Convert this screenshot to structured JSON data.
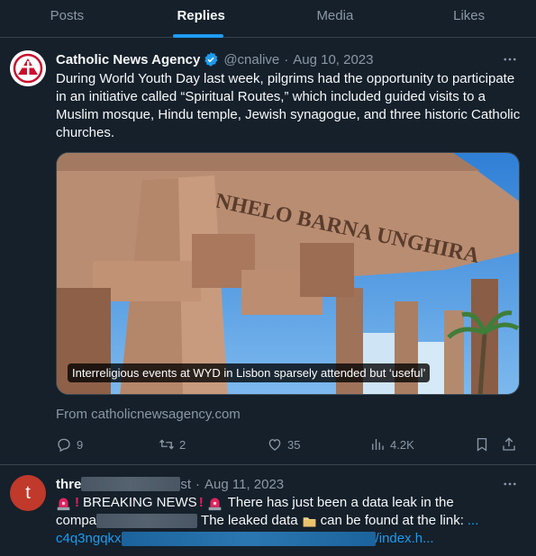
{
  "tabs": [
    {
      "label": "Posts"
    },
    {
      "label": "Replies"
    },
    {
      "label": "Media"
    },
    {
      "label": "Likes"
    }
  ],
  "tweet": {
    "name": "Catholic News Agency",
    "handle": "@cnalive",
    "separator": "·",
    "date": "Aug 10, 2023",
    "text": "During World Youth Day last week, pilgrims had the opportunity to participate in an initiative called “Spiritual Routes,” which included guided visits to a Muslim mosque, Hindu temple, Jewish synagogue, and three historic Catholic churches.",
    "card_caption": "Interreligious events at WYD in Lisbon sparsely attended but ‘useful’",
    "card_source": "From catholicnewsagency.com",
    "building_letters": "NHELO BARNA UNGHIRA",
    "actions": {
      "replies": "9",
      "reposts": "2",
      "likes": "35",
      "views": "4.2K"
    }
  },
  "reply": {
    "name_prefix": "thre",
    "name_suffix": "st",
    "separator": "·",
    "date": "Aug 11, 2023",
    "avatar_letter": "t",
    "line1_text": "BREAKING NEWS",
    "line1_tail": "There has just been a data leak in the",
    "line2_prefix": "compa",
    "line2_tail": "The leaked data",
    "line2_end": "can be found at the link:",
    "line2_ellipsis": "...",
    "link_prefix": "c4q3ngqkx",
    "link_suffix": "/index.h..."
  },
  "colors": {
    "background": "#15202b",
    "accent": "#1d9bf0",
    "text": "#f7f9f9",
    "muted": "#8b98a5",
    "border": "#38444d"
  },
  "icons": {
    "verified": "verified-badge-icon",
    "more": "more-icon",
    "reply": "reply-icon",
    "repost": "repost-icon",
    "like": "like-icon",
    "views": "views-icon",
    "bookmark": "bookmark-icon",
    "share": "share-icon",
    "siren": "siren-emoji",
    "exclamation": "exclamation-emoji",
    "folder": "folder-emoji"
  }
}
